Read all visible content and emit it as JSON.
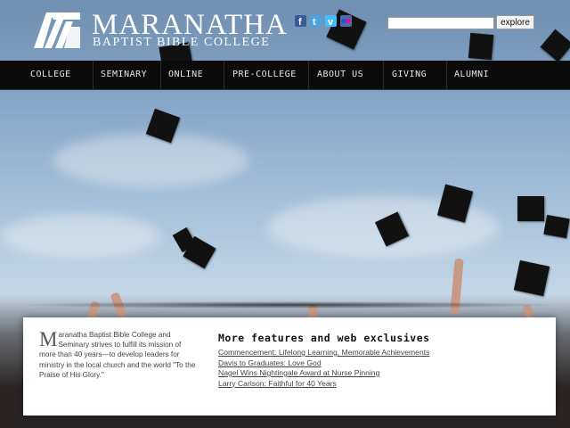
{
  "header": {
    "title": "MARANATHA",
    "subtitle": "BAPTIST BIBLE COLLEGE",
    "social_icons": [
      "facebook-icon",
      "twitter-icon",
      "vimeo-icon",
      "flickr-icon"
    ],
    "search": {
      "placeholder": "",
      "button_label": "explore"
    }
  },
  "nav": {
    "items": [
      {
        "label": "COLLEGE"
      },
      {
        "label": "SEMINARY"
      },
      {
        "label": "ONLINE"
      },
      {
        "label": "PRE-COLLEGE"
      },
      {
        "label": "ABOUT US"
      },
      {
        "label": "GIVING"
      },
      {
        "label": "ALUMNI"
      }
    ]
  },
  "mission": {
    "dropcap": "M",
    "text": "aranatha Baptist Bible College and Seminary strives to fulfill its mission of more than 40 years—to develop leaders for ministry in the local church and the world \"To the Praise of His Glory.\""
  },
  "features": {
    "title": "More features and web exclusives",
    "links": [
      "Commencement: Lifelong Learning, Memorable Achievements",
      "Davis to Graduates: Love God",
      "Nagel Wins Nightingale Award at Nurse Pinning",
      "Larry Carlson: Faithful for 40 Years"
    ]
  },
  "colors": {
    "nav_bg": "#0b0b0b",
    "header_text": "#ffffff",
    "panel_bg": "#ffffff"
  }
}
